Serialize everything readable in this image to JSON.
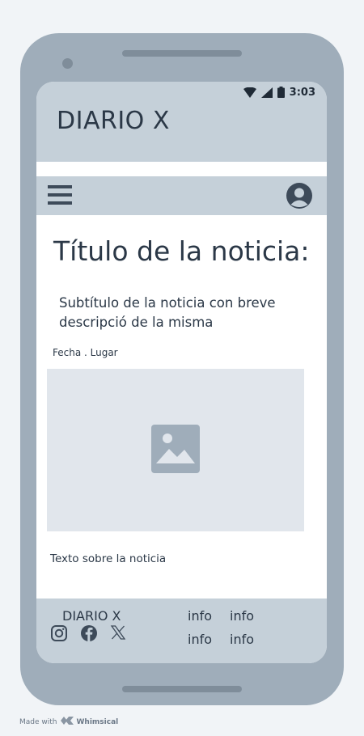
{
  "status_bar": {
    "time": "3:03"
  },
  "app": {
    "brand": "DIARIO X"
  },
  "article": {
    "title": "Título de la noticia:",
    "subtitle": "Subtítulo de la noticia con breve descripció de la misma",
    "meta": "Fecha . Lugar",
    "body": "Texto sobre la noticia"
  },
  "footer": {
    "brand": "DIARIO X",
    "social": [
      "instagram-icon",
      "facebook-icon",
      "x-icon"
    ],
    "info_links": [
      "info",
      "info",
      "info",
      "info"
    ]
  },
  "watermark": {
    "made_with": "Made with",
    "brand": "Whimsical"
  },
  "colors": {
    "background": "#f1f4f7",
    "phone_frame": "#9fadba",
    "header": "#c5d0d9",
    "image_placeholder": "#e1e6ec",
    "text": "#2b3847"
  }
}
